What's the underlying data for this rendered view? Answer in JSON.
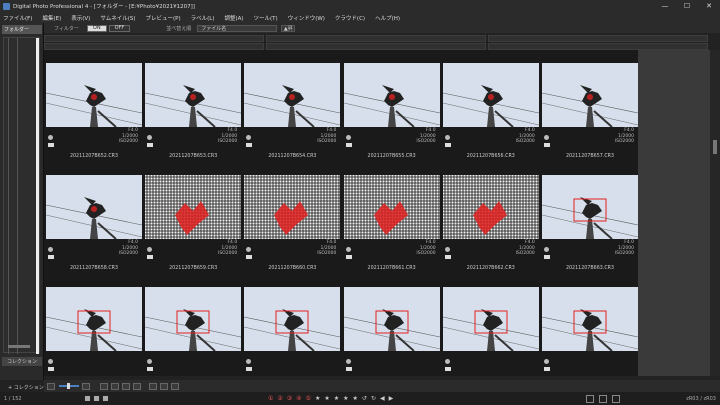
{
  "window": {
    "title": "Digital Photo Professional 4 - [フォルダー - [E:¥Photo¥2021¥1207]]",
    "controls": [
      "—",
      "☐",
      "✕"
    ]
  },
  "menu": [
    "ファイル(F)",
    "編集(E)",
    "表示(V)",
    "サムネイル(S)",
    "プレビュー(P)",
    "ラベル(L)",
    "調整(A)",
    "ツール(T)",
    "ウィンドウ(W)",
    "クラウド(C)",
    "ヘルプ(H)"
  ],
  "left_panel": {
    "folder_tab": "フォルダー",
    "collection_tab": "コレクション",
    "add_collection": "+ コレクション(A)"
  },
  "filter_bar": {
    "filter_label": "フィルター",
    "on_label": "ON",
    "off_label": "OFF",
    "sort_label": "並べ替え順",
    "sort_value": "ファイル名",
    "sort_order_label": "▲昇"
  },
  "thumbnails": [
    {
      "filename": "20211207B652.CR3",
      "aperture": "F4.0",
      "shutter": "1/2000",
      "iso": "ISO2000",
      "style": "plain"
    },
    {
      "filename": "20211207B653.CR3",
      "aperture": "F4.0",
      "shutter": "1/2000",
      "iso": "ISO2000",
      "style": "plain"
    },
    {
      "filename": "20211207B654.CR3",
      "aperture": "F4.0",
      "shutter": "1/2000",
      "iso": "ISO2000",
      "style": "plain"
    },
    {
      "filename": "20211207B655.CR3",
      "aperture": "F4.0",
      "shutter": "1/2000",
      "iso": "ISO2000",
      "style": "plain"
    },
    {
      "filename": "20211207B656.CR3",
      "aperture": "F4.0",
      "shutter": "1/2000",
      "iso": "ISO2000",
      "style": "plain"
    },
    {
      "filename": "20211207B657.CR3",
      "aperture": "F4.0",
      "shutter": "1/2000",
      "iso": "ISO2000",
      "style": "plain"
    },
    {
      "filename": "20211207B658.CR3",
      "aperture": "F4.0",
      "shutter": "1/2000",
      "iso": "ISO2000",
      "style": "plain"
    },
    {
      "filename": "20211207B659.CR3",
      "aperture": "F4.0",
      "shutter": "1/2000",
      "iso": "ISO2000",
      "style": "grid"
    },
    {
      "filename": "20211207B660.CR3",
      "aperture": "F4.0",
      "shutter": "1/2000",
      "iso": "ISO2000",
      "style": "grid"
    },
    {
      "filename": "20211207B661.CR3",
      "aperture": "F4.0",
      "shutter": "1/2000",
      "iso": "ISO2000",
      "style": "grid"
    },
    {
      "filename": "20211207B662.CR3",
      "aperture": "F4.0",
      "shutter": "1/2000",
      "iso": "ISO2000",
      "style": "grid"
    },
    {
      "filename": "20211207B663.CR3",
      "aperture": "F4.0",
      "shutter": "1/2000",
      "iso": "ISO2000",
      "style": "box"
    },
    {
      "filename": "",
      "aperture": "",
      "shutter": "",
      "iso": "",
      "style": "box"
    },
    {
      "filename": "",
      "aperture": "",
      "shutter": "",
      "iso": "",
      "style": "box"
    },
    {
      "filename": "",
      "aperture": "",
      "shutter": "",
      "iso": "",
      "style": "box"
    },
    {
      "filename": "",
      "aperture": "",
      "shutter": "",
      "iso": "",
      "style": "box"
    },
    {
      "filename": "",
      "aperture": "",
      "shutter": "",
      "iso": "",
      "style": "box"
    },
    {
      "filename": "",
      "aperture": "",
      "shutter": "",
      "iso": "",
      "style": "box"
    }
  ],
  "status": {
    "count": "1 / 152",
    "right_count": "zR03 / zR03"
  },
  "colors": {
    "accent": "#4a7fc1",
    "sky": "#d7dfec",
    "highlight_red": "#e02020"
  },
  "icons": {
    "rotate": "rotate-icon",
    "window_min": "minimize-icon",
    "window_max": "maximize-icon",
    "window_close": "close-icon"
  }
}
